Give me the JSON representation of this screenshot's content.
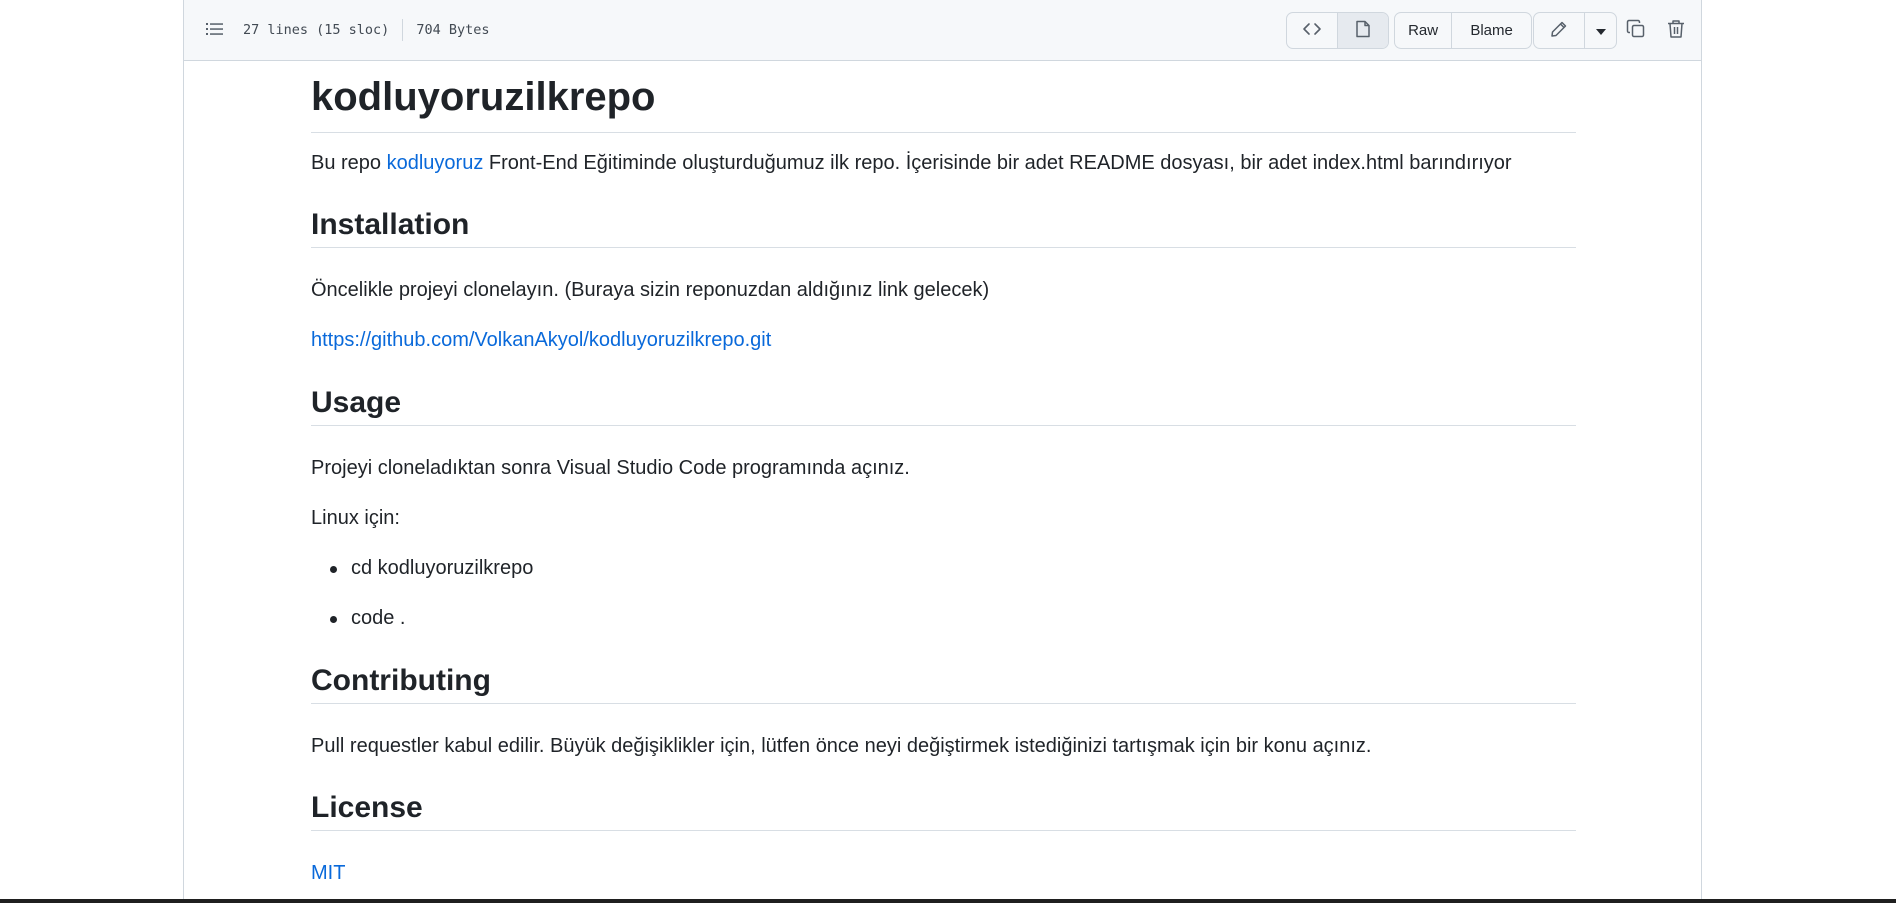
{
  "file_header": {
    "lines": "27 lines (15 sloc)",
    "size": "704 Bytes",
    "raw_label": "Raw",
    "blame_label": "Blame"
  },
  "readme": {
    "title": "kodluyoruzilkrepo",
    "intro_prefix": "Bu repo ",
    "intro_link": "kodluyoruz",
    "intro_suffix": " Front-End Eğitiminde oluşturduğumuz ilk repo. İçerisinde bir adet README dosyası, bir adet index.html barındırıyor",
    "installation": {
      "heading": "Installation",
      "text": "Öncelikle projeyi clonelayın. (Buraya sizin reponuzdan aldığınız link gelecek)",
      "link": "https://github.com/VolkanAkyol/kodluyoruzilkrepo.git"
    },
    "usage": {
      "heading": "Usage",
      "text": "Projeyi cloneladıktan sonra Visual Studio Code programında açınız.",
      "linux_label": "Linux için:",
      "items": [
        "cd kodluyoruzilkrepo",
        "code ."
      ]
    },
    "contributing": {
      "heading": "Contributing",
      "text": "Pull requestler kabul edilir. Büyük değişiklikler için, lütfen önce neyi değiştirmek istediğinizi tartışmak için bir konu açınız."
    },
    "license": {
      "heading": "License",
      "link": "MIT"
    }
  },
  "icons": {
    "outline": "list-unordered-icon",
    "code": "code-icon",
    "preview": "file-icon",
    "edit": "pencil-icon",
    "dropdown": "triangle-down-icon",
    "copy": "copy-icon",
    "delete": "trash-icon"
  },
  "colors": {
    "link": "#0969da",
    "text": "#1f2328",
    "header_bg": "#f6f8fa",
    "border": "#d0d7de"
  }
}
